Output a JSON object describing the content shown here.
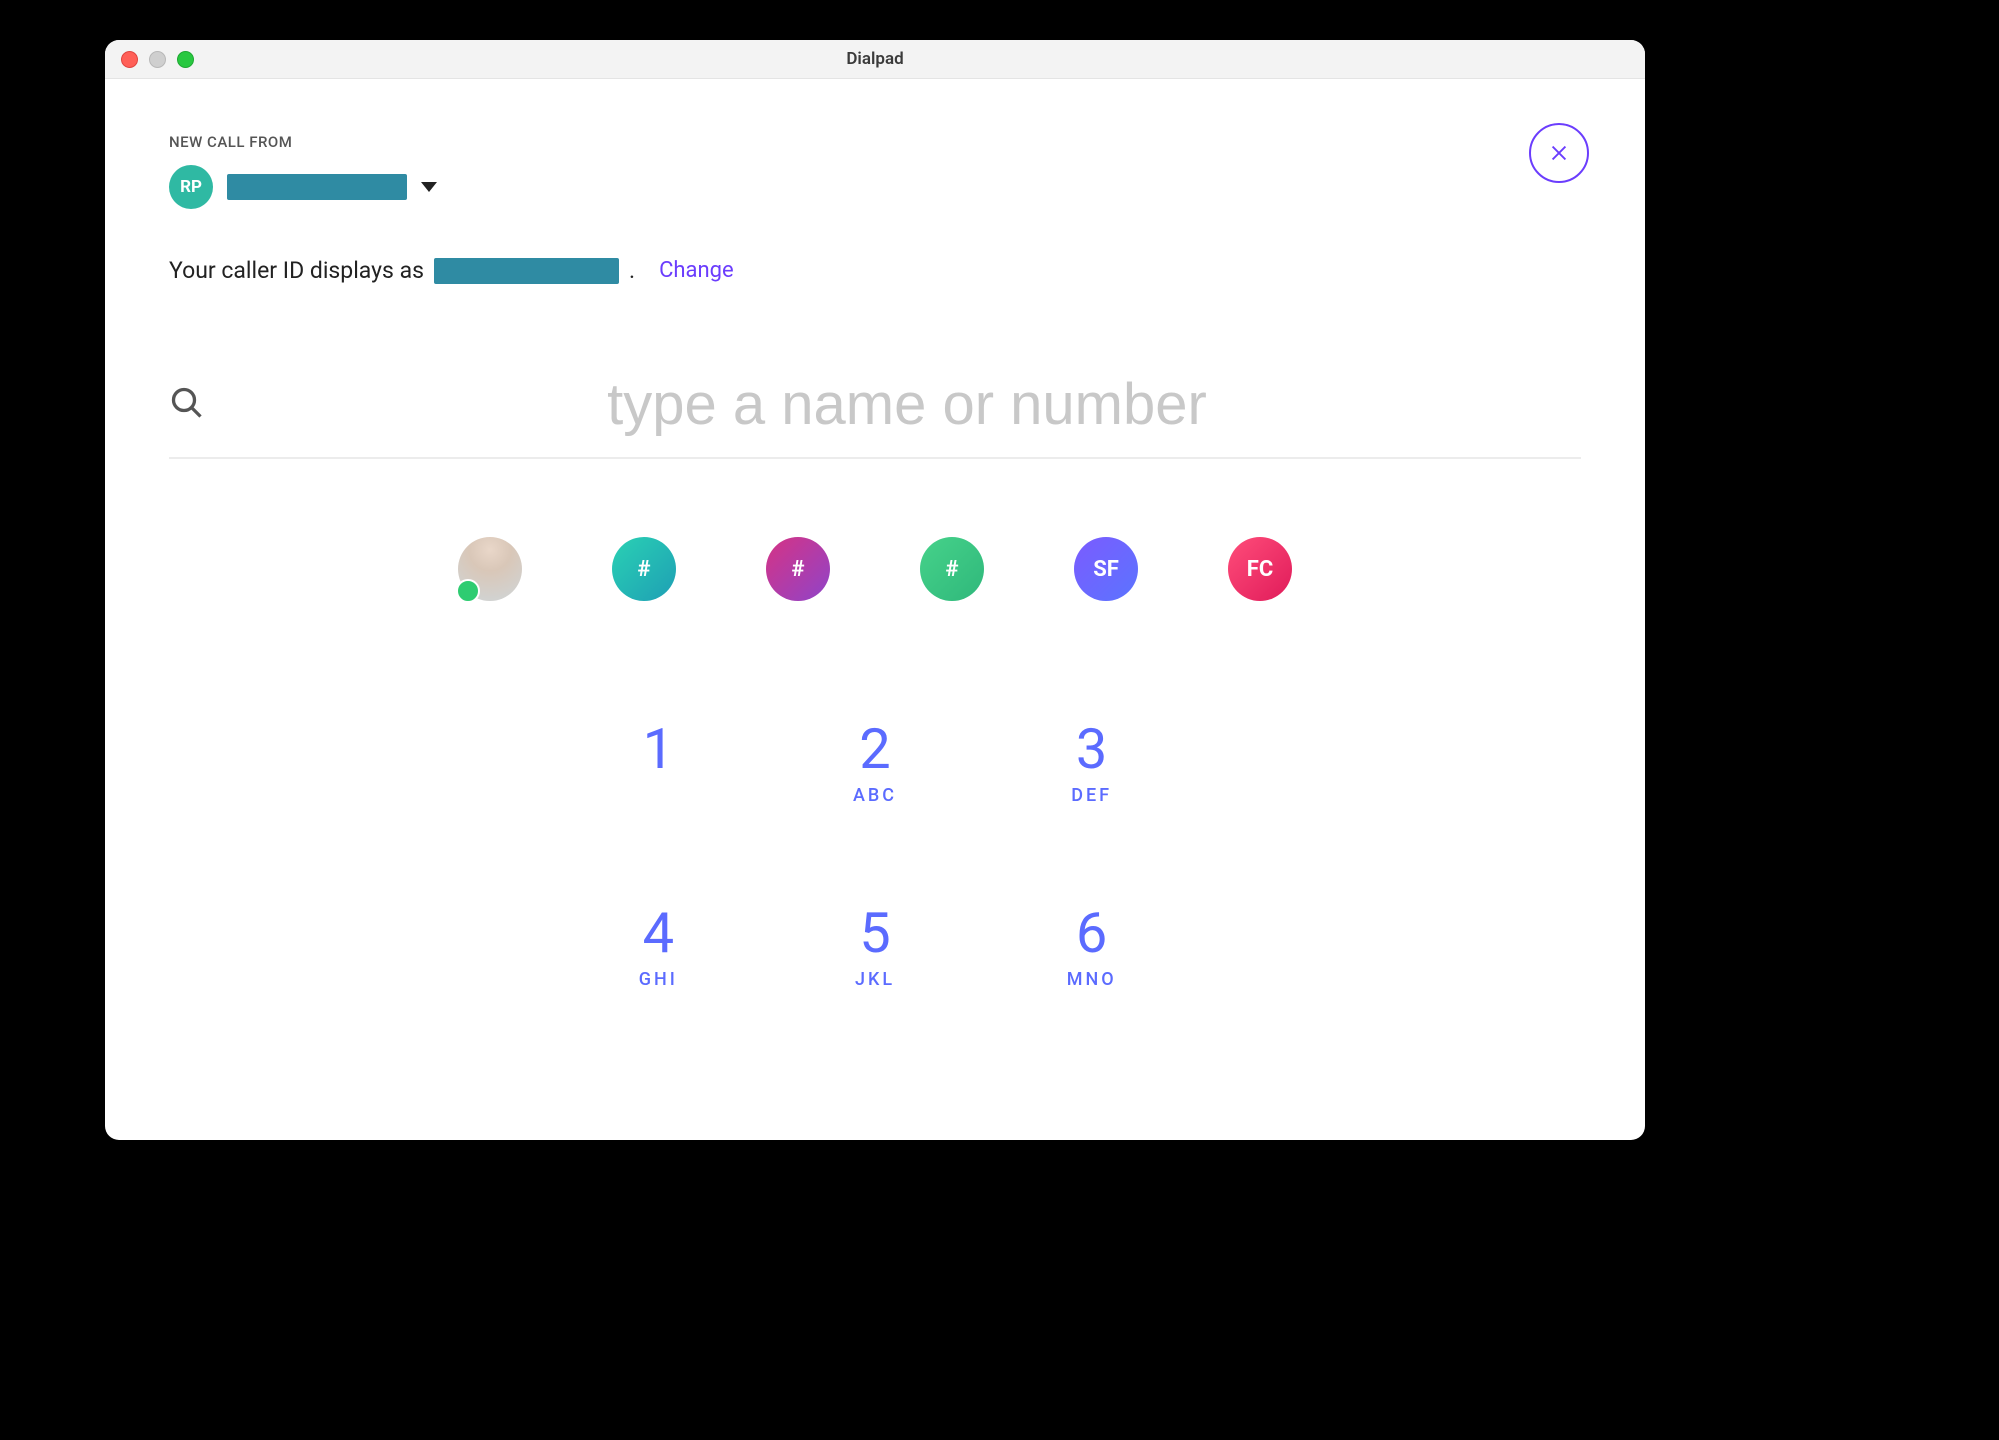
{
  "window": {
    "title": "Dialpad"
  },
  "header": {
    "label": "NEW CALL FROM",
    "avatar_initials": "RP"
  },
  "caller_id": {
    "prefix": "Your caller ID displays as ",
    "change_label": "Change"
  },
  "search": {
    "placeholder": "type a name or number",
    "value": ""
  },
  "contacts": [
    {
      "kind": "photo",
      "display": "",
      "presence": true
    },
    {
      "kind": "hash",
      "display": "#",
      "css": "c-teal"
    },
    {
      "kind": "hash",
      "display": "#",
      "css": "c-pink"
    },
    {
      "kind": "hash",
      "display": "#",
      "css": "c-green"
    },
    {
      "kind": "initials",
      "display": "SF",
      "css": "c-blue"
    },
    {
      "kind": "initials",
      "display": "FC",
      "css": "c-red"
    }
  ],
  "keypad": [
    {
      "digit": "1",
      "letters": ""
    },
    {
      "digit": "2",
      "letters": "ABC"
    },
    {
      "digit": "3",
      "letters": "DEF"
    },
    {
      "digit": "4",
      "letters": "GHI"
    },
    {
      "digit": "5",
      "letters": "JKL"
    },
    {
      "digit": "6",
      "letters": "MNO"
    }
  ]
}
